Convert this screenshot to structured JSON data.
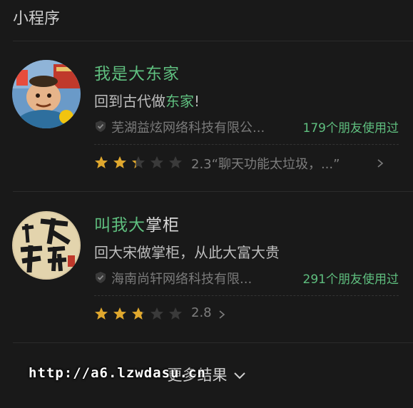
{
  "section_title": "小程序",
  "results": [
    {
      "title_highlight": "我是大东家",
      "title_rest": "",
      "desc_before": "回到古代做",
      "desc_highlight": "东家",
      "desc_after": "!",
      "company": "芜湖益炫网络科技有限公...",
      "friends": "179个朋友使用过",
      "rating": 2.3,
      "rating_text": "2.3“聊天功能太垃圾，...”",
      "icon": "game-avatar-merchant-icon"
    },
    {
      "title_highlight": "叫我大",
      "title_rest": "掌柜",
      "desc_before": "回大宋做掌柜，从此大富大贵",
      "desc_highlight": "",
      "desc_after": "",
      "company": "海南尚轩网络科技有限...",
      "friends": "291个朋友使用过",
      "rating": 2.8,
      "rating_text": "2.8",
      "icon": "game-avatar-calligraphy-icon"
    }
  ],
  "more_label": "更多结果",
  "watermark": "http://a6.lzwdasu.cn",
  "colors": {
    "highlight": "#5fbf7f",
    "star_filled": "#e0a82e",
    "star_empty": "#3a3a3a",
    "background": "#191919"
  }
}
